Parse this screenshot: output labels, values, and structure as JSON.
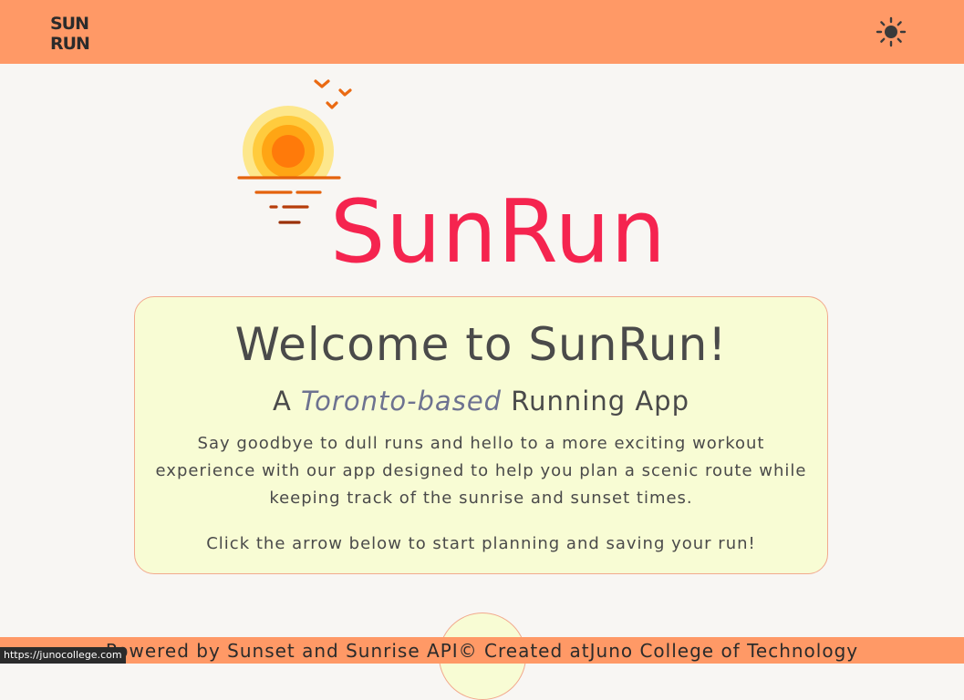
{
  "app": {
    "logo_text_top": "SUN",
    "logo_text_bottom": "RUN",
    "brand_title": "SunRun",
    "theme_icon": "sun-icon"
  },
  "welcome": {
    "heading": "Welcome to SunRun!",
    "subtitle_prefix": "A ",
    "subtitle_italic": "Toronto-based",
    "subtitle_suffix": " Running App",
    "description": "Say goodbye to dull runs and hello to a more exciting workout experience with our app designed to help you plan a scenic route while keeping track of the sunrise and sunset times.",
    "cta_text": "Click the arrow below to start planning and saving your run!"
  },
  "footer": {
    "text": "Powered by Sunset and Sunrise API© Created atJuno College of Technology"
  },
  "status_bar": {
    "url": "https://junocollege.com"
  },
  "colors": {
    "header_bg": "#ff9966",
    "brand_red": "#f5244f",
    "card_bg": "#f8fcd4",
    "card_border": "#f2a98d",
    "page_bg": "#f8f6f3"
  }
}
